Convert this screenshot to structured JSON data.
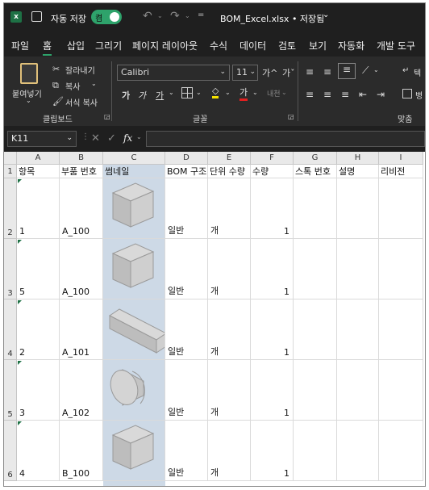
{
  "titlebar": {
    "autosave_label": "자동 저장",
    "autosave_state": "켬",
    "file_title": "BOM_Excel.xlsx • 저장됨",
    "accent": "#1e7145",
    "toggle_color": "#2ea36b"
  },
  "menu": [
    "파일",
    "홈",
    "삽입",
    "그리기",
    "페이지 레이아웃",
    "수식",
    "데이터",
    "검토",
    "보기",
    "자동화",
    "개발 도구"
  ],
  "ribbon": {
    "paste_label": "붙여넣기",
    "cut_label": "잘라내기",
    "copy_label": "복사",
    "format_painter_label": "서식 복사",
    "clipboard_group": "클립보드",
    "font_name": "Calibri",
    "font_size": "11",
    "font_group": "글꼴",
    "align_group": "맞춤",
    "grow_font": "가^",
    "shrink_font": "가ˇ",
    "bold": "가",
    "italic": "가",
    "underline": "가",
    "font_color_label": "가",
    "phonetic": "내천",
    "wrap_text_short": "텍",
    "merge_short": "병"
  },
  "formula_bar": {
    "name_box": "K11",
    "fx": "fx",
    "value": ""
  },
  "columns": [
    "A",
    "B",
    "C",
    "D",
    "E",
    "F",
    "G",
    "H",
    "I"
  ],
  "headers": [
    "항목",
    "부품 번호",
    "썸네일",
    "BOM 구조",
    "단위 수량",
    "수량",
    "스톡 번호",
    "설명",
    "리비전"
  ],
  "rows": [
    {
      "row": "2",
      "item": "1",
      "part": "A_100",
      "bom": "일반",
      "unit": "개",
      "qty": "1",
      "shape": "box"
    },
    {
      "row": "3",
      "item": "5",
      "part": "A_100",
      "bom": "일반",
      "unit": "개",
      "qty": "1",
      "shape": "box"
    },
    {
      "row": "4",
      "item": "2",
      "part": "A_101",
      "bom": "일반",
      "unit": "개",
      "qty": "1",
      "shape": "bar"
    },
    {
      "row": "5",
      "item": "3",
      "part": "A_102",
      "bom": "일반",
      "unit": "개",
      "qty": "1",
      "shape": "cylinder"
    },
    {
      "row": "6",
      "item": "4",
      "part": "B_100",
      "bom": "일반",
      "unit": "개",
      "qty": "1",
      "shape": "box"
    }
  ]
}
